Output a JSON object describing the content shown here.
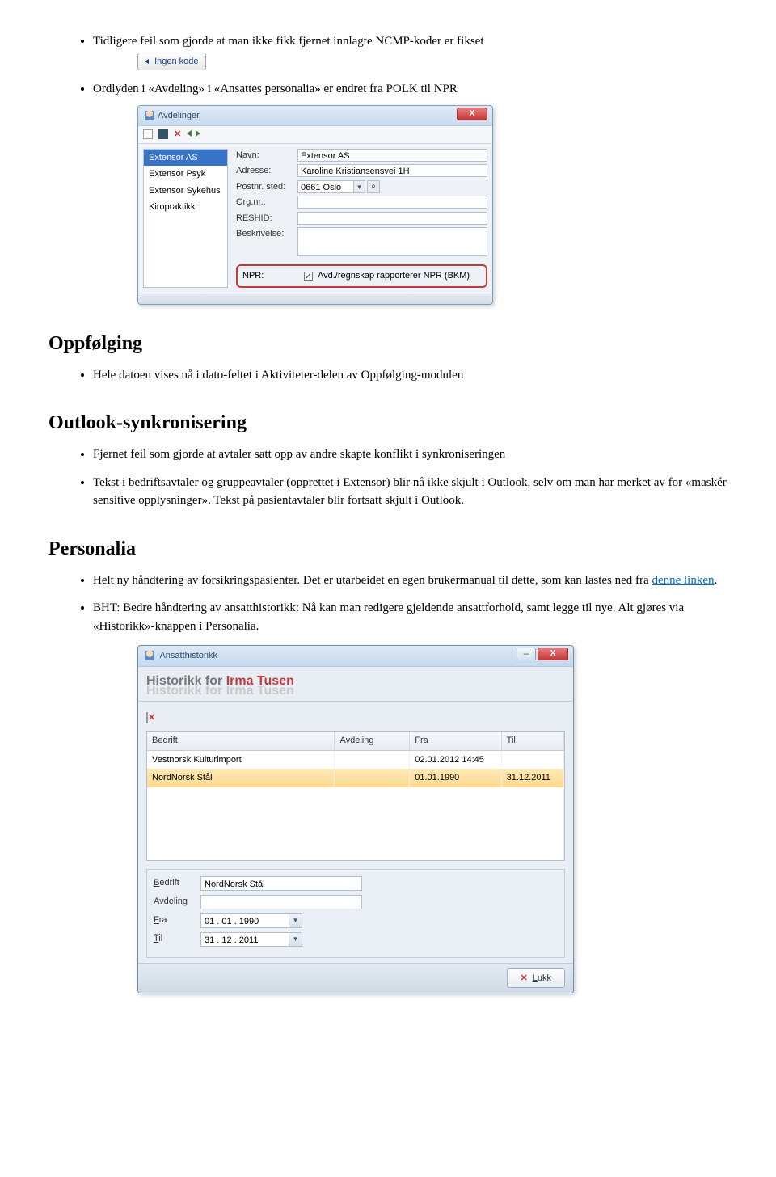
{
  "bullets": {
    "ncmp": "Tidligere feil som gjorde at man ikke fikk fjernet innlagte NCMP-koder er fikset",
    "ordlyden": "Ordlyden i «Avdeling» i «Ansattes personalia» er endret fra POLK til NPR"
  },
  "ingen_kode": "Ingen kode",
  "avdelinger_dialog": {
    "title": "Avdelinger",
    "sidebar": [
      "Extensor AS",
      "Extensor Psyk",
      "Extensor Sykehus",
      "Kiropraktikk"
    ],
    "fields": {
      "navn_label": "Navn:",
      "navn_value": "Extensor AS",
      "adresse_label": "Adresse:",
      "adresse_value": "Karoline Kristiansensvei 1H",
      "postnr_label": "Postnr. sted:",
      "postnr_value": "0661 Oslo",
      "orgnr_label": "Org.nr.:",
      "reshid_label": "RESHID:",
      "beskrivelse_label": "Beskrivelse:",
      "npr_label": "NPR:",
      "npr_check_text": "Avd./regnskap rapporterer NPR (BKM)"
    }
  },
  "sections": {
    "oppfolging_title": "Oppfølging",
    "oppfolging_b1": "Hele datoen vises nå i dato-feltet i Aktiviteter-delen av Oppfølging-modulen",
    "outlook_title": "Outlook-synkronisering",
    "outlook_b1": "Fjernet feil som gjorde at avtaler satt opp av andre skapte konflikt i synkroniseringen",
    "outlook_b2": "Tekst i bedriftsavtaler og gruppeavtaler (opprettet i Extensor) blir nå ikke skjult i Outlook, selv om man har merket av for «maskér sensitive opplysninger». Tekst på pasientavtaler blir fortsatt skjult i Outlook.",
    "personalia_title": "Personalia",
    "personalia_b1a": "Helt ny håndtering av forsikringspasienter. Det er utarbeidet en egen brukermanual til dette, som kan lastes ned fra ",
    "personalia_b1_link": "denne linken",
    "personalia_b1b": ".",
    "personalia_b2": "BHT: Bedre håndtering av ansatthistorikk: Nå kan man redigere gjeldende ansattforhold, samt legge til nye. Alt gjøres via «Historikk»-knappen i Personalia."
  },
  "hist_dialog": {
    "wintitle": "Ansatthistorikk",
    "heading_prefix": "Historikk for ",
    "heading_name": "Irma Tusen",
    "shadow": "Historikk for Irma Tusen",
    "cols": {
      "bedrift": "Bedrift",
      "avdeling": "Avdeling",
      "fra": "Fra",
      "til": "Til"
    },
    "rows": [
      {
        "bedrift": "Vestnorsk Kulturimport",
        "avdeling": "",
        "fra": "02.01.2012 14:45",
        "til": ""
      },
      {
        "bedrift": "NordNorsk Stål",
        "avdeling": "",
        "fra": "01.01.1990",
        "til": "31.12.2011"
      }
    ],
    "form": {
      "bedrift_label": "Bedrift",
      "bedrift_value": "NordNorsk Stål",
      "avdeling_label": "Avdeling",
      "avdeling_value": "",
      "fra_label": "Fra",
      "fra_value": "01 . 01 . 1990",
      "til_label": "Til",
      "til_value": "31 . 12 . 2011"
    },
    "lukk": "Lukk"
  }
}
